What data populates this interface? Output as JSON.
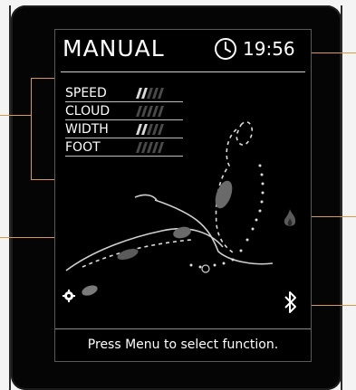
{
  "screen": {
    "title": "MANUAL",
    "clock": "19:56",
    "footer": "Press Menu to select function."
  },
  "settings": [
    {
      "label": "SPEED",
      "level": 2,
      "max": 5
    },
    {
      "label": "CLOUD",
      "level": 0,
      "max": 5
    },
    {
      "label": "WIDTH",
      "level": 2,
      "max": 5
    },
    {
      "label": "FOOT",
      "level": 0,
      "max": 5
    }
  ],
  "icons": {
    "clock": "clock-icon",
    "heat": "flame-icon",
    "bluetooth": "bluetooth-icon",
    "settings": "gear-icon",
    "figure": "seated-person-icon"
  },
  "colors": {
    "screen": "#000000",
    "text": "#ffffff",
    "leader": "#d89a4a",
    "inactive": "#4a4a4a"
  }
}
